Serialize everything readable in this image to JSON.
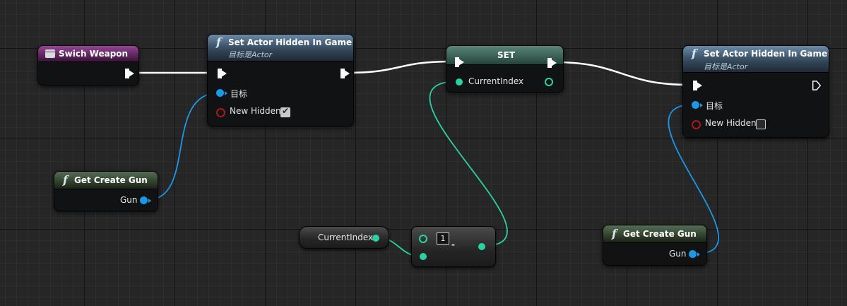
{
  "nodes": {
    "switch_event": {
      "title": "Swich Weapon"
    },
    "set_hidden_1": {
      "title": "Set Actor Hidden In Game",
      "subtitle": "目标是Actor",
      "target_label": "目标",
      "new_hidden_label": "New Hidden",
      "new_hidden_checked": true
    },
    "set_var": {
      "title": "SET",
      "pin_label": "CurrentIndex"
    },
    "set_hidden_2": {
      "title": "Set Actor Hidden In Game",
      "subtitle": "目标是Actor",
      "target_label": "目标",
      "new_hidden_label": "New Hidden",
      "new_hidden_checked": false
    },
    "get_gun_1": {
      "title": "Get Create Gun",
      "output_label": "Gun"
    },
    "get_gun_2": {
      "title": "Get Create Gun",
      "output_label": "Gun"
    },
    "current_index_get": {
      "label": "CurrentIndex"
    },
    "subtract": {
      "value": "1",
      "operator": "-"
    }
  },
  "colors": {
    "exec_wire": "#ffffff",
    "object_pin": "#1d97e8",
    "integer_pin": "#27d3a2",
    "boolean_pin": "#a81b1b"
  },
  "icons": {
    "function": "f",
    "event": "event-icon"
  }
}
